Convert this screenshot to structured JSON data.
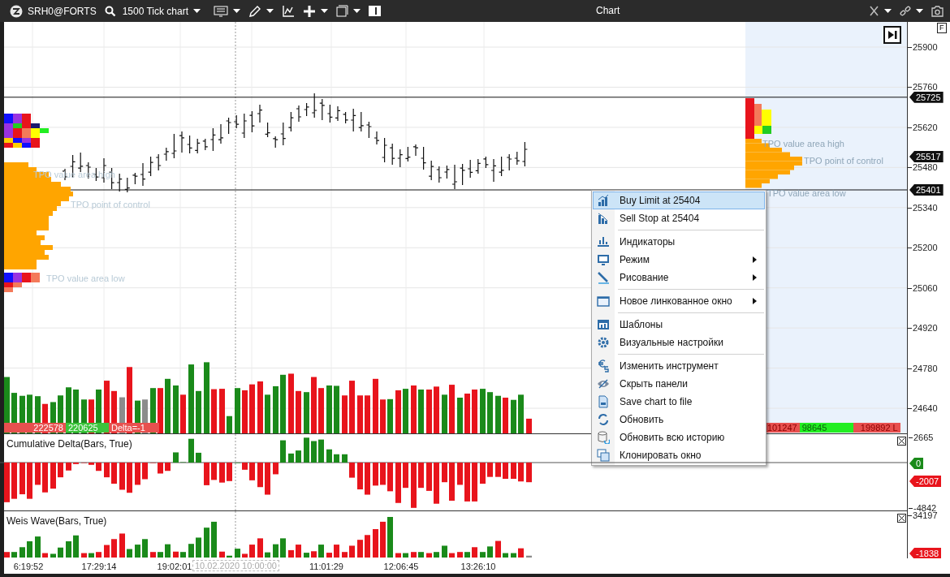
{
  "toolbar": {
    "instrument": "SRH0@FORTS",
    "chart_type": "1500 Tick chart",
    "title": "Chart"
  },
  "price_pane": {
    "f_button": "F",
    "axis_ticks": [
      "25900",
      "25760",
      "25620",
      "25480",
      "25340",
      "25200",
      "25060",
      "24920",
      "24780",
      "24640"
    ],
    "price_tags": [
      "25725",
      "25517",
      "25401"
    ],
    "profile_labels_left": [
      "TPO value area high",
      "TPO point of control",
      "TPO value area low"
    ],
    "profile_labels_right": [
      "TPO value area high",
      "TPO point of control",
      "TPO value area low"
    ],
    "volume_labels_left": [
      {
        "text": "222578",
        "color": "#e8504f"
      },
      {
        "text": "220625",
        "color": "#3cc43c"
      },
      {
        "text": "Delta=-1",
        "color": "#e8504f"
      }
    ],
    "volume_labels_right": [
      {
        "text": "101247",
        "color": "#e8504f"
      },
      {
        "text": "98645",
        "color": "#22ee22"
      },
      {
        "text": "199892 L",
        "color": "#e8504f"
      }
    ]
  },
  "delta_pane": {
    "title": "Cumulative Delta(Bars, True)",
    "axis_ticks": [
      "2665",
      "-4842"
    ],
    "tags": [
      {
        "text": "0",
        "color": "#1a8a1a"
      },
      {
        "text": "-2007",
        "color": "#e8141c"
      }
    ]
  },
  "weis_pane": {
    "title": "Weis Wave(Bars, True)",
    "axis_ticks": [
      "34197"
    ],
    "tags": [
      {
        "text": "-1838",
        "color": "#e8141c"
      }
    ]
  },
  "time_axis": {
    "labels": [
      "6:19:52",
      "17:29:14",
      "19:02:01",
      "11:01:29",
      "12:06:45",
      "13:26:10"
    ],
    "cursor_label": "10.02.2020 10:00:00"
  },
  "context_menu": {
    "groups": [
      [
        {
          "label": "Buy Limit at 25404",
          "selected": true,
          "submenu": false
        },
        {
          "label": "Sell Stop at 25404",
          "selected": false,
          "submenu": false
        }
      ],
      [
        {
          "label": "Индикаторы",
          "selected": false,
          "submenu": false
        },
        {
          "label": "Режим",
          "selected": false,
          "submenu": true
        },
        {
          "label": "Рисование",
          "selected": false,
          "submenu": true
        }
      ],
      [
        {
          "label": "Новое линкованное окно",
          "selected": false,
          "submenu": true
        }
      ],
      [
        {
          "label": "Шаблоны",
          "selected": false,
          "submenu": false
        },
        {
          "label": "Визуальные настройки",
          "selected": false,
          "submenu": false
        }
      ],
      [
        {
          "label": "Изменить инструмент",
          "selected": false,
          "submenu": false
        },
        {
          "label": "Скрыть панели",
          "selected": false,
          "submenu": false
        },
        {
          "label": "Save chart to file",
          "selected": false,
          "submenu": false
        },
        {
          "label": "Обновить",
          "selected": false,
          "submenu": false
        },
        {
          "label": "Обновить всю историю",
          "selected": false,
          "submenu": false
        },
        {
          "label": "Клонировать окно",
          "selected": false,
          "submenu": false
        }
      ]
    ]
  }
}
